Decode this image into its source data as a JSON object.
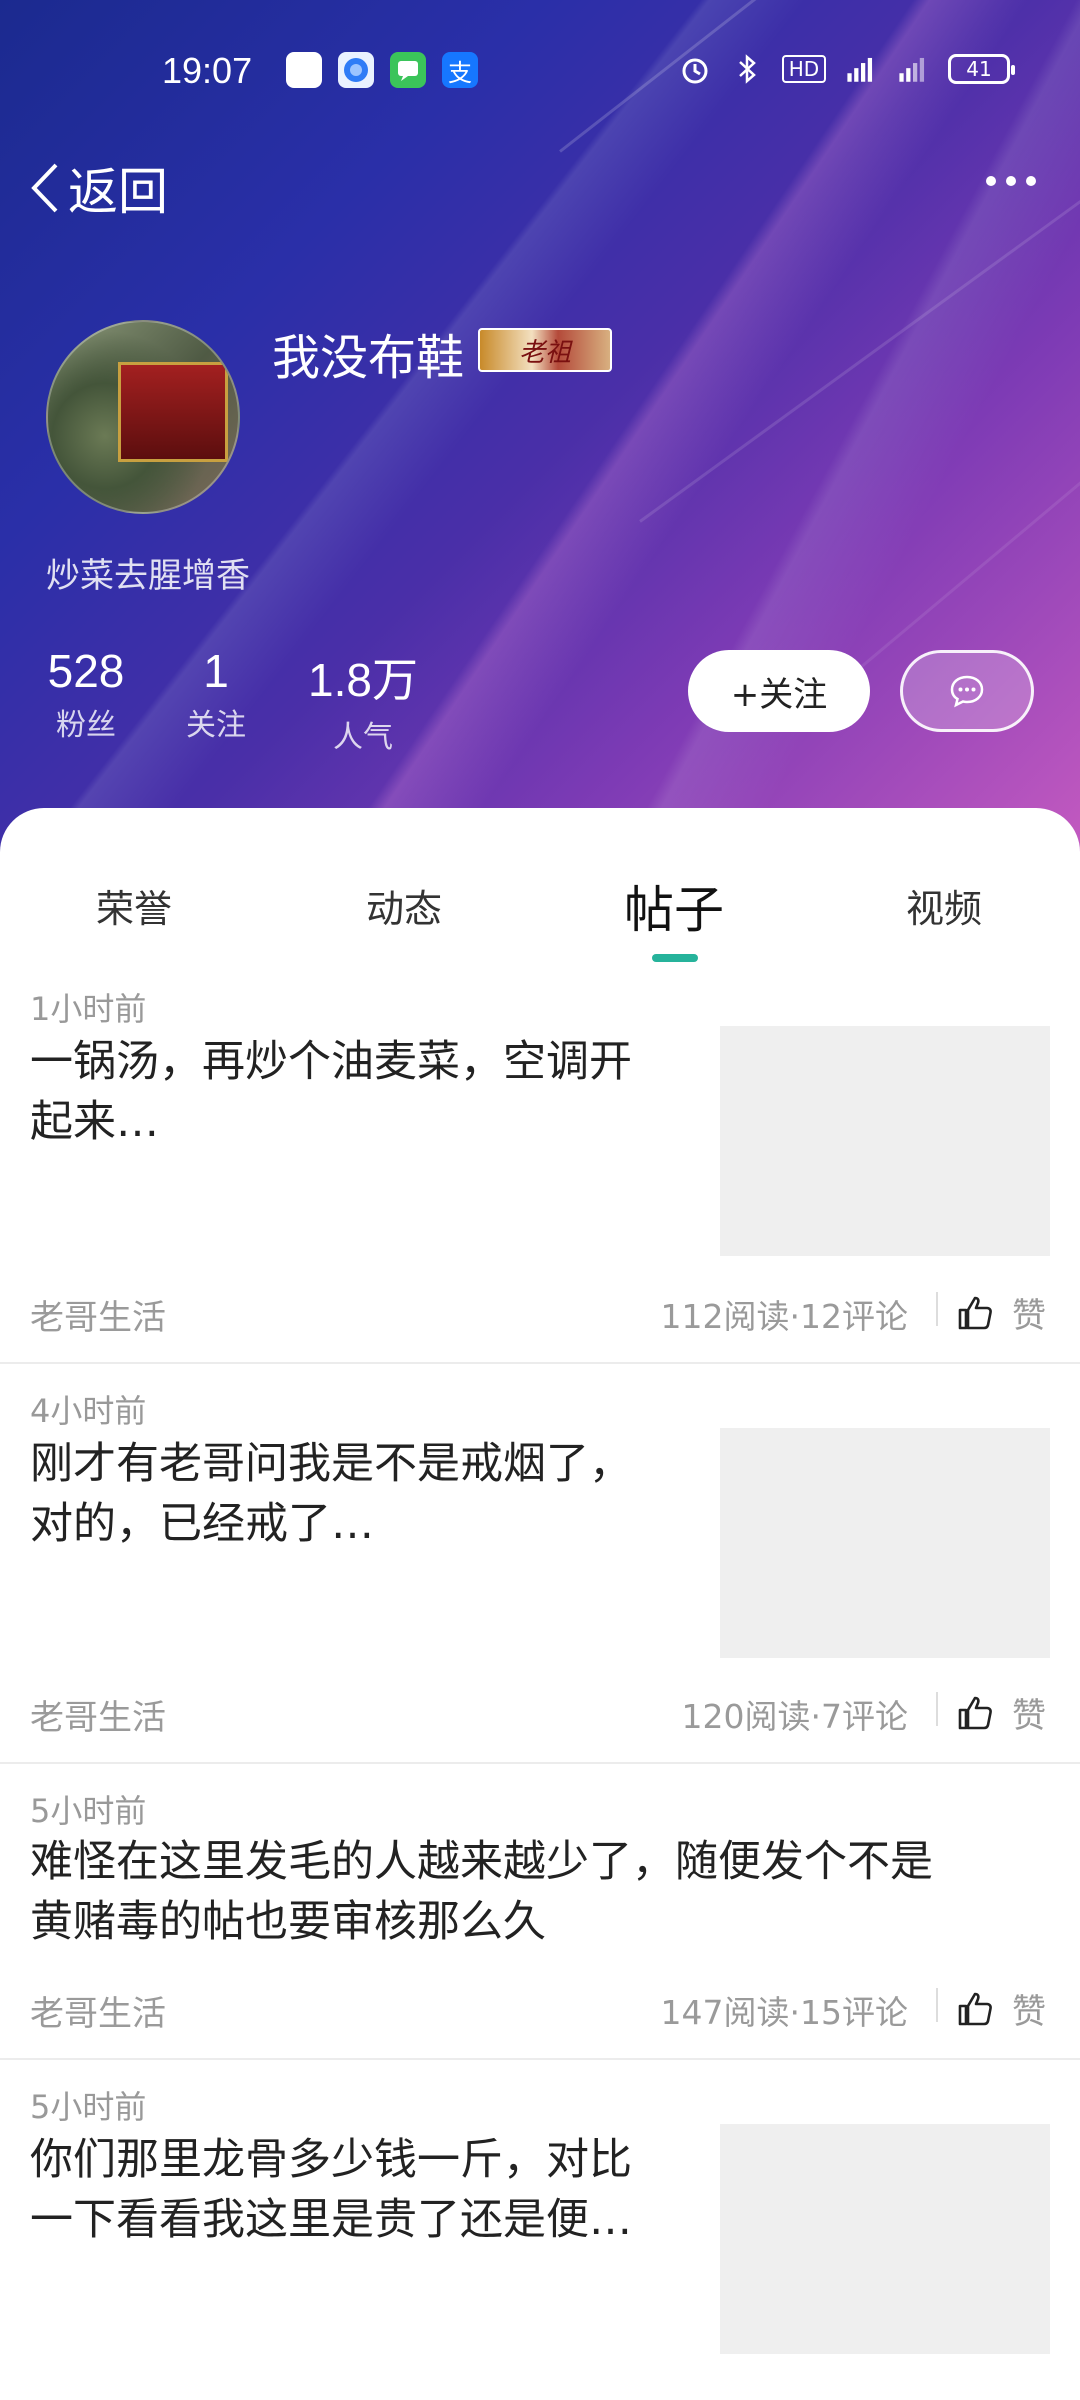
{
  "status_bar": {
    "time": "19:07",
    "battery": "41",
    "hd": "HD",
    "net": "4G"
  },
  "nav": {
    "back_label": "返回"
  },
  "profile": {
    "name": "我没布鞋",
    "badge_text": "老祖",
    "bio": "炒菜去腥增香",
    "stats": [
      {
        "value": "528",
        "label": "粉丝"
      },
      {
        "value": "1",
        "label": "关注"
      },
      {
        "value": "1.8万",
        "label": "人气"
      }
    ],
    "follow_label": "+关注"
  },
  "tabs": [
    {
      "label": "荣誉"
    },
    {
      "label": "动态"
    },
    {
      "label": "帖子"
    },
    {
      "label": "视频"
    }
  ],
  "active_tab": "帖子",
  "accent_color": "#26b39b",
  "posts": [
    {
      "time": "1小时前",
      "title_line1": "一锅汤，再炒个油麦菜，空调开",
      "title_line2": "起来…",
      "source": "老哥生活",
      "meta": "112阅读·12评论",
      "like_label": "赞"
    },
    {
      "time": "4小时前",
      "title_line1": "刚才有老哥问我是不是戒烟了，",
      "title_line2": "对的，已经戒了…",
      "source": "老哥生活",
      "meta": "120阅读·7评论",
      "like_label": "赞"
    },
    {
      "time": "5小时前",
      "title_line1": "难怪在这里发毛的人越来越少了，随便发个不是",
      "title_line2": "黄赌毒的帖也要审核那么久",
      "source": "老哥生活",
      "meta": "147阅读·15评论",
      "like_label": "赞"
    },
    {
      "time": "5小时前",
      "title_line1": "你们那里龙骨多少钱一斤，对比",
      "title_line2": "一下看看我这里是贵了还是便…",
      "source": "老哥生活",
      "meta": "",
      "like_label": ""
    }
  ]
}
